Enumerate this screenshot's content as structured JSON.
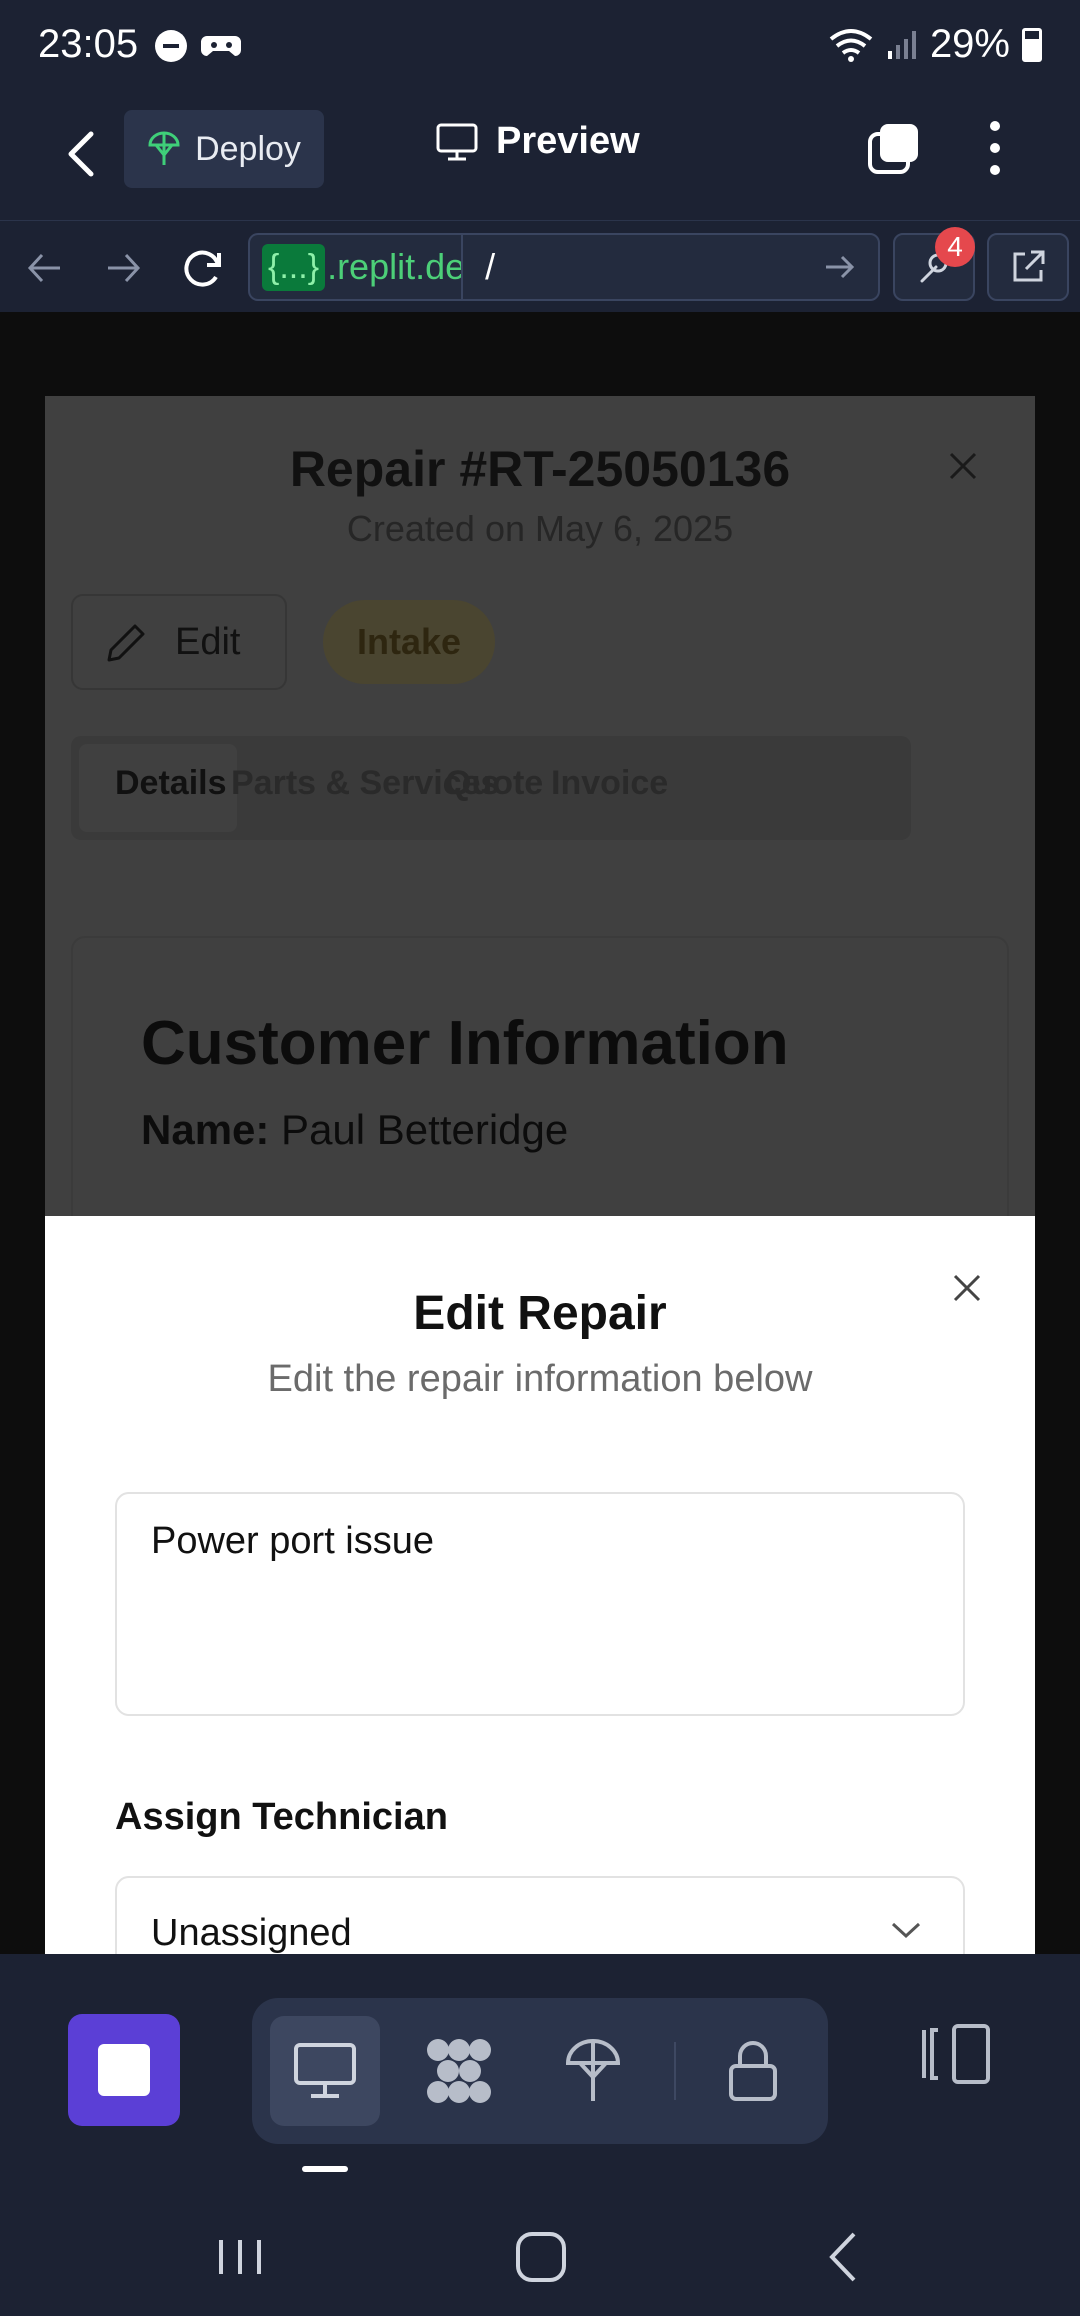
{
  "status_bar": {
    "time": "23:05",
    "battery": "29%",
    "icons": [
      "do-not-disturb-icon",
      "game-controller-icon",
      "wifi-icon",
      "signal-icon",
      "battery-icon"
    ]
  },
  "toolbar": {
    "deploy_label": "Deploy",
    "preview_label": "Preview"
  },
  "url_bar": {
    "domain_tag": "{...}",
    "domain": ".replit.de",
    "path": "/",
    "badge_count": "4"
  },
  "repair_dialog": {
    "title": "Repair #RT-25050136",
    "created": "Created on May 6, 2025",
    "edit_label": "Edit",
    "status": "Intake",
    "tabs": [
      "Details",
      "Parts & Services",
      "Quote",
      "Invoice"
    ],
    "card_title": "Customer Information",
    "name_label": "Name:",
    "name_value": " Paul Betteridge"
  },
  "edit_sheet": {
    "title": "Edit Repair",
    "subtitle": "Edit the repair information below",
    "description_value": "Power port issue",
    "technician_label": "Assign Technician",
    "technician_value": "Unassigned"
  },
  "colors": {
    "chrome_bg": "#1c2233",
    "stop_button": "#5b3fd6",
    "domain_green": "#4ccf78",
    "badge_red": "#e5484d"
  }
}
